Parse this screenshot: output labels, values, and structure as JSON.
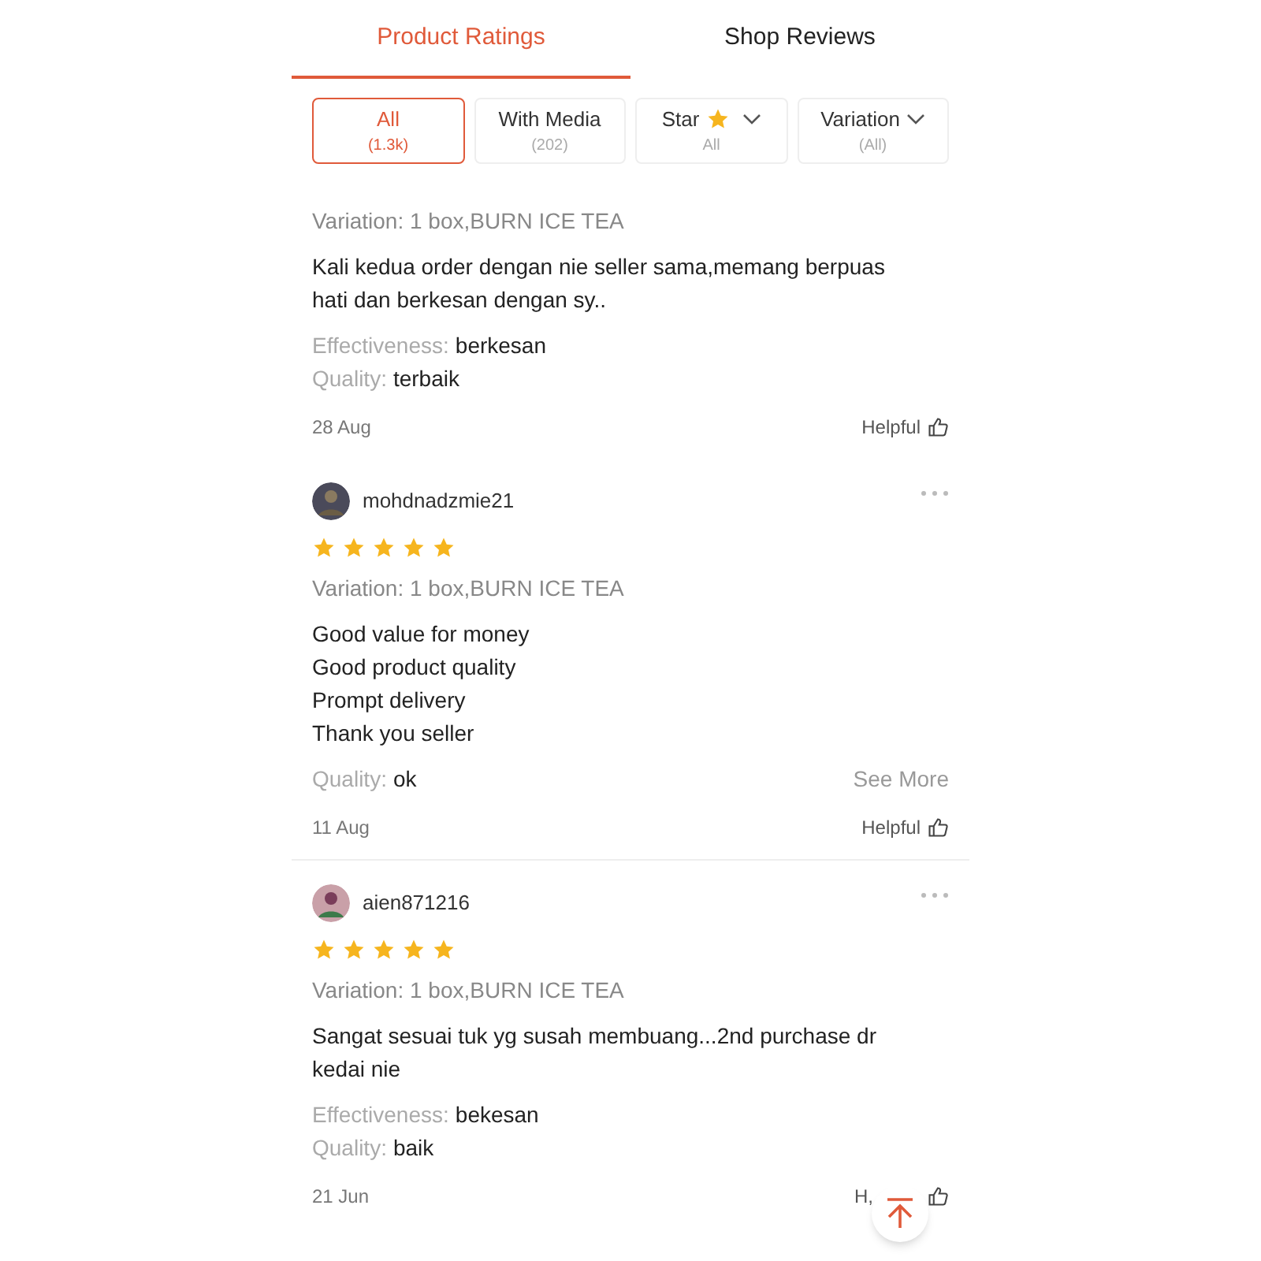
{
  "tabs": [
    {
      "label": "Product Ratings",
      "selected": true
    },
    {
      "label": "Shop Reviews",
      "selected": false
    }
  ],
  "filters": [
    {
      "label": "All",
      "sub": "(1.3k)",
      "selected": true,
      "kind": "plain"
    },
    {
      "label": "With Media",
      "sub": "(202)",
      "selected": false,
      "kind": "plain"
    },
    {
      "label": "Star",
      "sub": "All",
      "selected": false,
      "kind": "star"
    },
    {
      "label": "Variation",
      "sub": "(All)",
      "selected": false,
      "kind": "dropdown"
    }
  ],
  "reviews": [
    {
      "variation": "Variation: 1 box,BURN ICE TEA",
      "body": [
        "Kali kedua order dengan nie seller sama,memang berpuas hati dan berkesan dengan sy.."
      ],
      "attributes": [
        {
          "label": "Effectiveness:",
          "value": "berkesan"
        },
        {
          "label": "Quality:",
          "value": "terbaik"
        }
      ],
      "date": "28 Aug",
      "helpful": "Helpful"
    },
    {
      "user": "mohdnadzmie21",
      "stars": 5,
      "variation": "Variation: 1 box,BURN ICE TEA",
      "body": [
        "Good value for money",
        "Good product quality",
        "Prompt delivery",
        "Thank you seller"
      ],
      "attributes": [
        {
          "label": "Quality:",
          "value": "ok"
        }
      ],
      "see_more": "See More",
      "date": "11 Aug",
      "helpful": "Helpful"
    },
    {
      "user": "aien871216",
      "stars": 5,
      "variation": "Variation: 1 box,BURN ICE TEA",
      "body": [
        "Sangat sesuai tuk yg susah membuang...2nd purchase dr kedai nie"
      ],
      "attributes": [
        {
          "label": "Effectiveness:",
          "value": "bekesan"
        },
        {
          "label": "Quality:",
          "value": "baik"
        }
      ],
      "date": "21 Jun",
      "helpful": "H,"
    }
  ],
  "scroll_to_top": true
}
